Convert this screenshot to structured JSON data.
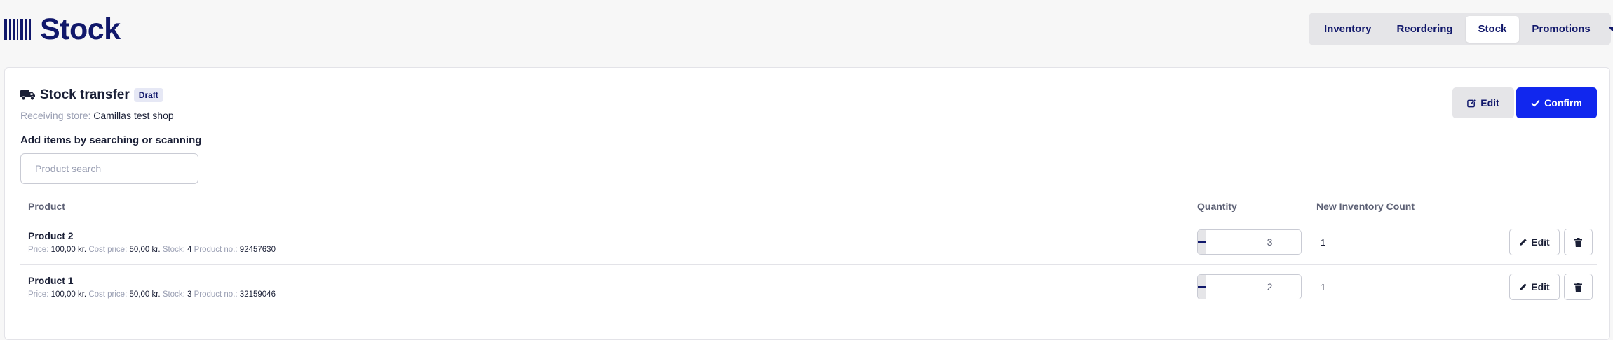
{
  "app": {
    "logo_icon": "barcode-icon",
    "title": "Stock"
  },
  "nav": {
    "tabs": [
      {
        "label": "Inventory",
        "active": false
      },
      {
        "label": "Reordering",
        "active": false
      },
      {
        "label": "Stock",
        "active": true
      },
      {
        "label": "Promotions",
        "active": false
      }
    ],
    "more_icon": "caret-down-icon"
  },
  "transfer": {
    "icon": "truck-icon",
    "title": "Stock transfer",
    "status": "Draft",
    "receiving_label": "Receiving store:",
    "receiving_value": "Camillas test shop",
    "edit_label": "Edit",
    "confirm_label": "Confirm"
  },
  "search": {
    "label": "Add items by searching or scanning",
    "placeholder": "Product search",
    "value": ""
  },
  "table": {
    "headers": {
      "product": "Product",
      "quantity": "Quantity",
      "new_count": "New Inventory Count"
    },
    "meta_labels": {
      "price": "Price",
      "cost": "Cost price",
      "stock": "Stock",
      "product_no": "Product no.:"
    },
    "row_edit_label": "Edit",
    "rows": [
      {
        "name": "Product 2",
        "price": "100,00 kr.",
        "cost": "50,00 kr.",
        "stock": "4",
        "product_no": "92457630",
        "quantity": "3",
        "new_count": "1"
      },
      {
        "name": "Product 1",
        "price": "100,00 kr.",
        "cost": "50,00 kr.",
        "stock": "3",
        "product_no": "32159046",
        "quantity": "2",
        "new_count": "1"
      }
    ]
  },
  "colors": {
    "brand": "#11186b",
    "primary": "#1127ee",
    "muted": "#9a9fb3",
    "badge_bg": "#e6e8f5"
  }
}
